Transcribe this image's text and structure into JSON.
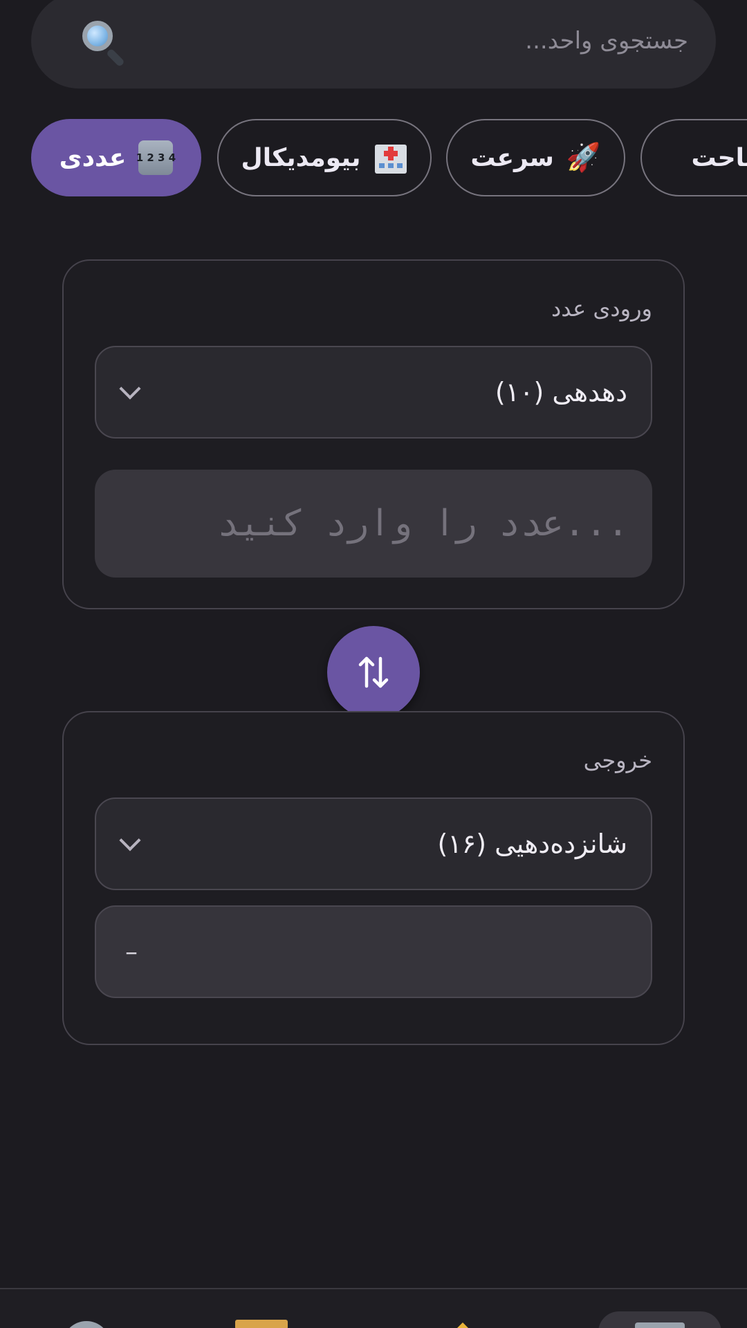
{
  "search": {
    "placeholder": "جستجوی واحد...",
    "icon": "search-icon"
  },
  "categories": [
    {
      "label": "ساحت",
      "icon": "area-icon",
      "active": false
    },
    {
      "label": "سرعت",
      "icon": "rocket-icon",
      "active": false
    },
    {
      "label": "بیومدیکال",
      "icon": "hospital-icon",
      "active": false
    },
    {
      "label": "عددی",
      "icon": "numbers-icon",
      "emoji_text": "1 2 3 4",
      "active": true
    }
  ],
  "input_card": {
    "label": "ورودی عدد",
    "unit_selected": "دهدهی (۱۰)",
    "value_placeholder": "...عدد را وارد کنید"
  },
  "swap_button": {
    "icon": "swap-vertical-icon"
  },
  "output_card": {
    "label": "خروجی",
    "unit_selected": "شانزده‌دهیی (۱۶)",
    "value": "–"
  },
  "bottom_nav": {
    "items": [
      "history-icon",
      "notes-icon",
      "star-icon",
      "converter-icon"
    ],
    "active_index": 3
  },
  "colors": {
    "background": "#1c1b20",
    "accent": "#6a55a3",
    "surface": "#2b2a30"
  }
}
